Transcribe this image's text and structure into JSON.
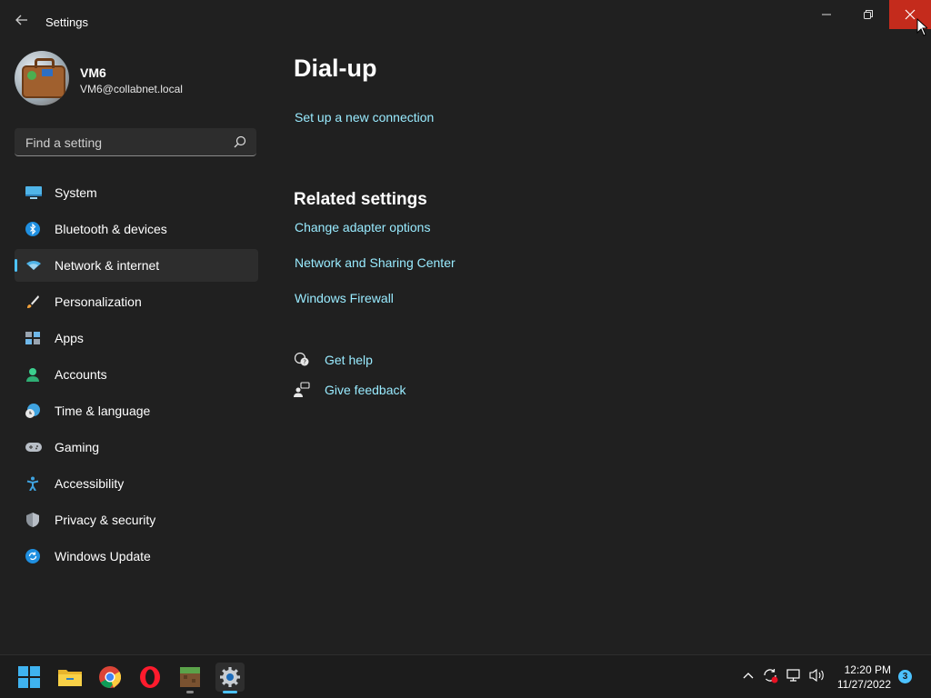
{
  "window": {
    "app_title": "Settings",
    "controls": {
      "minimize": "—",
      "maximize": "❐",
      "close": "✕"
    }
  },
  "profile": {
    "name": "VM6",
    "email": "VM6@collabnet.local"
  },
  "search": {
    "placeholder": "Find a setting",
    "value": ""
  },
  "sidebar": {
    "selected": "Network & internet",
    "items": [
      {
        "label": "System",
        "icon": "monitor-icon"
      },
      {
        "label": "Bluetooth & devices",
        "icon": "bluetooth-icon"
      },
      {
        "label": "Network & internet",
        "icon": "wifi-icon"
      },
      {
        "label": "Personalization",
        "icon": "brush-icon"
      },
      {
        "label": "Apps",
        "icon": "apps-icon"
      },
      {
        "label": "Accounts",
        "icon": "person-icon"
      },
      {
        "label": "Time & language",
        "icon": "globe-clock-icon"
      },
      {
        "label": "Gaming",
        "icon": "gamepad-icon"
      },
      {
        "label": "Accessibility",
        "icon": "accessibility-icon"
      },
      {
        "label": "Privacy & security",
        "icon": "shield-icon"
      },
      {
        "label": "Windows Update",
        "icon": "update-icon"
      }
    ]
  },
  "main": {
    "title": "Dial-up",
    "setup_link": "Set up a new connection",
    "related_title": "Related settings",
    "related_links": [
      "Change adapter options",
      "Network and Sharing Center",
      "Windows Firewall"
    ],
    "help": {
      "get_help": "Get help",
      "give_feedback": "Give feedback"
    }
  },
  "taskbar": {
    "apps": [
      "start-icon",
      "file-explorer-icon",
      "chrome-icon",
      "opera-icon",
      "minecraft-icon",
      "settings-icon"
    ],
    "time": "12:20 PM",
    "date": "11/27/2022",
    "notification_count": "3"
  },
  "colors": {
    "accent": "#4cc2ff",
    "link": "#99ebff",
    "background": "#202020",
    "close_hover": "#c42b1c"
  }
}
